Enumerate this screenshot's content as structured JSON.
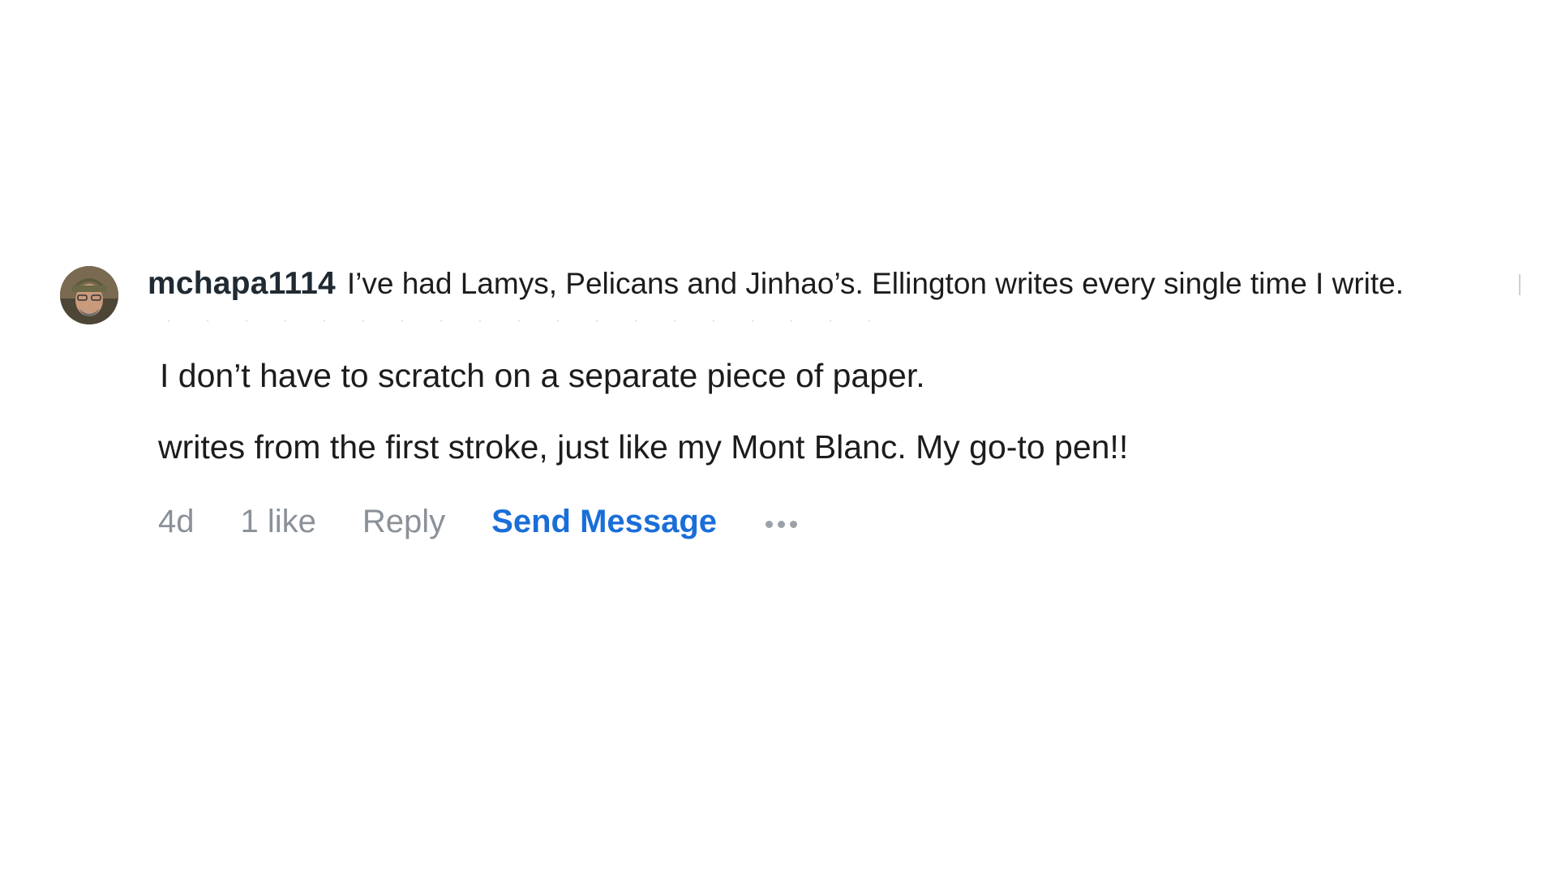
{
  "comment": {
    "username": "mchapa1114",
    "first_line": "I’ve had Lamys, Pelicans and Jinhao’s. Ellington writes every single time I write.",
    "body_line_1": "I don’t have to scratch on a separate piece of paper.",
    "body_line_2": "writes from the first stroke, just like my Mont Blanc. My go-to pen!!",
    "avatar_icon": "user-avatar-photo"
  },
  "actions": {
    "time": "4d",
    "likes": "1 like",
    "reply": "Reply",
    "send_message": "Send Message",
    "more_icon": "more-dots-icon"
  },
  "colors": {
    "username": "#1f2a33",
    "text": "#1c1c1c",
    "muted": "#8a9199",
    "accent": "#1a6ed8"
  }
}
